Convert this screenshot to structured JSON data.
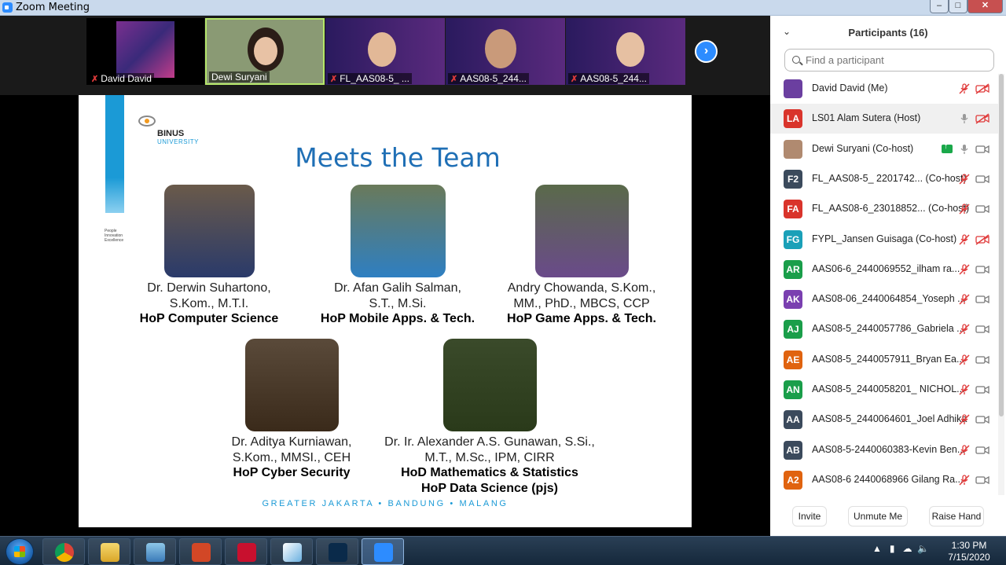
{
  "window": {
    "title": "Zoom Meeting"
  },
  "video_strip": {
    "tiles": [
      {
        "name": "David David",
        "muted": true
      },
      {
        "name": "Dewi Suryani",
        "muted": false
      },
      {
        "name": "FL_AAS08-5_ ...",
        "muted": true
      },
      {
        "name": "AAS08-5_244...",
        "muted": true
      },
      {
        "name": "AAS08-5_244...",
        "muted": true
      }
    ]
  },
  "slide": {
    "university_name": "BINUS",
    "university_sub": "UNIVERSITY",
    "tagline": "People Innovation Excellence",
    "title": "Meets the Team",
    "people": [
      {
        "line1": "Dr. Derwin Suhartono,",
        "line2": "S.Kom., M.T.I.",
        "role": "HoP Computer Science"
      },
      {
        "line1": "Dr. Afan Galih Salman,",
        "line2": "S.T., M.Si.",
        "role": "HoP Mobile Apps. & Tech."
      },
      {
        "line1": "Andry Chowanda, S.Kom.,",
        "line2": "MM., PhD., MBCS, CCP",
        "role": "HoP Game Apps. & Tech."
      },
      {
        "line1": "Dr. Aditya Kurniawan,",
        "line2": "S.Kom., MMSI., CEH",
        "role": "HoP Cyber Security"
      },
      {
        "line1": "Dr. Ir. Alexander A.S. Gunawan, S.Si.,",
        "line2": "M.T., M.Sc., IPM, CIRR",
        "role": "HoD Mathematics & Statistics",
        "role2": "HoP Data Science (pjs)"
      }
    ],
    "footer": "GREATER JAKARTA • BANDUNG • MALANG"
  },
  "participants": {
    "title": "Participants (16)",
    "search_placeholder": "Find a participant",
    "list": [
      {
        "initials": "",
        "color": "#6b3fa0",
        "name": "David David (Me)",
        "mic": "muted",
        "cam": "off"
      },
      {
        "initials": "LA",
        "color": "#d9342b",
        "name": "LS01 Alam Sutera (Host)",
        "mic": "on",
        "cam": "off"
      },
      {
        "initials": "",
        "color": "#b08a70",
        "name": "Dewi Suryani (Co-host)",
        "mic": "on",
        "cam": "on",
        "sharing": true
      },
      {
        "initials": "F2",
        "color": "#3b4a5c",
        "name": "FL_AAS08-5_ 2201742... (Co-host)",
        "mic": "muted",
        "cam": "on"
      },
      {
        "initials": "FA",
        "color": "#d9342b",
        "name": "FL_AAS08-6_23018852... (Co-host)",
        "mic": "muted",
        "cam": "on"
      },
      {
        "initials": "FG",
        "color": "#1aa0b8",
        "name": "FYPL_Jansen Guisaga (Co-host)",
        "mic": "muted",
        "cam": "off"
      },
      {
        "initials": "AR",
        "color": "#1a9e4a",
        "name": "AAS06-6_2440069552_ilham ra...",
        "mic": "muted",
        "cam": "on"
      },
      {
        "initials": "AK",
        "color": "#7a3fb0",
        "name": "AAS08-06_2440064854_Yoseph ...",
        "mic": "muted",
        "cam": "on"
      },
      {
        "initials": "AJ",
        "color": "#1a9e4a",
        "name": "AAS08-5_2440057786_Gabriela ...",
        "mic": "muted",
        "cam": "on"
      },
      {
        "initials": "AE",
        "color": "#e0630f",
        "name": "AAS08-5_2440057911_Bryan Ea...",
        "mic": "muted",
        "cam": "on"
      },
      {
        "initials": "AN",
        "color": "#1a9e4a",
        "name": "AAS08-5_2440058201_ NICHOL...",
        "mic": "muted",
        "cam": "on"
      },
      {
        "initials": "AA",
        "color": "#3b4a5c",
        "name": "AAS08-5_2440064601_Joel Adhika",
        "mic": "muted",
        "cam": "on"
      },
      {
        "initials": "AB",
        "color": "#3b4a5c",
        "name": "AAS08-5-2440060383-Kevin Ben...",
        "mic": "muted",
        "cam": "on"
      },
      {
        "initials": "A2",
        "color": "#e0630f",
        "name": "AAS08-6 2440068966 Gilang Ra...",
        "mic": "muted",
        "cam": "on"
      }
    ],
    "buttons": {
      "invite": "Invite",
      "unmute": "Unmute Me",
      "raise": "Raise Hand"
    }
  },
  "taskbar": {
    "apps": [
      "chrome-icon",
      "explorer-icon",
      "notes-icon",
      "powerpoint-icon",
      "acrobat-icon",
      "paint-icon",
      "photoshop-icon",
      "zoom-icon"
    ],
    "time": "1:30 PM",
    "date": "7/15/2020"
  }
}
